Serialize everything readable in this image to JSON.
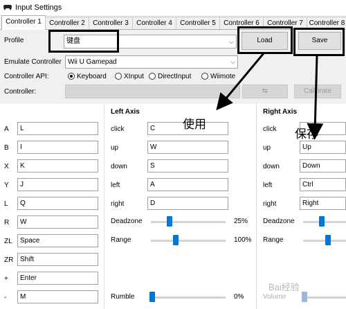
{
  "window": {
    "title": "Input Settings"
  },
  "tabs": [
    "Controller 1",
    "Controller 2",
    "Controller 3",
    "Controller 4",
    "Controller 5",
    "Controller 6",
    "Controller 7",
    "Controller 8"
  ],
  "profile": {
    "label": "Profile",
    "value": "键盘",
    "load_label": "Load",
    "save_label": "Save"
  },
  "emulate": {
    "label": "Emulate Controller",
    "value": "Wii U Gamepad"
  },
  "api": {
    "label": "Controller API:",
    "options": [
      "Keyboard",
      "XInput",
      "DirectInput",
      "Wiimote"
    ],
    "selected": "Keyboard"
  },
  "controller": {
    "label": "Controller:",
    "value": "",
    "calibrate_label": "Calibrate"
  },
  "buttons": [
    {
      "key": "A",
      "value": "L"
    },
    {
      "key": "B",
      "value": "I"
    },
    {
      "key": "X",
      "value": "K"
    },
    {
      "key": "Y",
      "value": "J"
    },
    {
      "key": "L",
      "value": "Q"
    },
    {
      "key": "R",
      "value": "W"
    },
    {
      "key": "ZL",
      "value": "Space"
    },
    {
      "key": "ZR",
      "value": "Shift"
    },
    {
      "key": "+",
      "value": "Enter"
    },
    {
      "key": "-",
      "value": "M"
    }
  ],
  "left_axis": {
    "title": "Left Axis",
    "rows": [
      {
        "key": "click",
        "value": "C"
      },
      {
        "key": "up",
        "value": "W"
      },
      {
        "key": "down",
        "value": "S"
      },
      {
        "key": "left",
        "value": "A"
      },
      {
        "key": "right",
        "value": "D"
      }
    ],
    "deadzone": {
      "label": "Deadzone",
      "value": "25%",
      "level": 0.25
    },
    "range": {
      "label": "Range",
      "value": "100%",
      "level": 0.33
    }
  },
  "right_axis": {
    "title": "Right Axis",
    "rows": [
      {
        "key": "click",
        "value": ""
      },
      {
        "key": "up",
        "value": "Up"
      },
      {
        "key": "down",
        "value": "Down"
      },
      {
        "key": "left",
        "value": "Ctrl"
      },
      {
        "key": "right",
        "value": "Right"
      }
    ],
    "deadzone": {
      "label": "Deadzone"
    },
    "range": {
      "label": "Range"
    }
  },
  "rumble": {
    "label": "Rumble",
    "value": "0%",
    "level": 0.0
  },
  "volume": {
    "label": "Volume"
  },
  "annotations": {
    "use": "使用",
    "save": "保存"
  },
  "watermark": "Bai经验"
}
